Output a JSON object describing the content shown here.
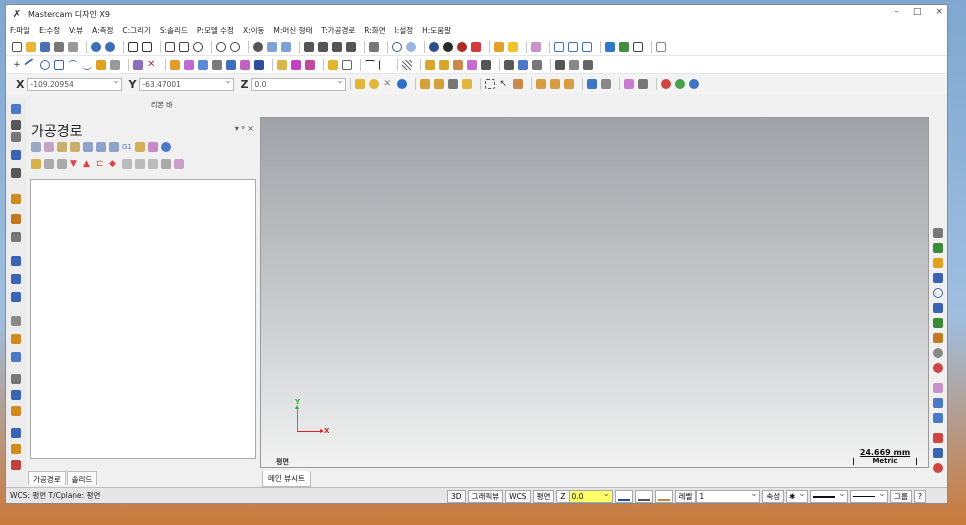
{
  "window": {
    "title": "Mastercam 디자인 X9",
    "controls": [
      "–",
      "□",
      "×"
    ]
  },
  "menu": {
    "items": [
      "F:파일",
      "E:수정",
      "V:뷰",
      "A:측정",
      "C:그리기",
      "S:솔리드",
      "P:모델 수정",
      "X:이동",
      "M:머신 형태",
      "T:가공경로",
      "R:화면",
      "I:설정",
      "H:도움말"
    ]
  },
  "coords": {
    "x_label": "X",
    "x_value": "-109.20954",
    "y_label": "Y",
    "y_value": "-63.47001",
    "z_label": "Z",
    "z_value": "0.0"
  },
  "ribbon": {
    "label": "리본 바"
  },
  "toolpaths_panel": {
    "title": "가공경로",
    "pin": "▾ ᵠ ×",
    "tabs": [
      "가공경로",
      "솔리드"
    ]
  },
  "viewport": {
    "x_axis": "X",
    "y_axis": "Y",
    "plane_name": "평면",
    "scale_value": "24.669 mm",
    "scale_unit": "Metric",
    "viewsheet_tab": "메인 뷰시트",
    "background_top": "#9fa3a7",
    "background_bottom": "#f2f2f2"
  },
  "status": {
    "left_text": "WCS: 평면  T/Cplane: 평면",
    "btn_3d": "3D",
    "btn_gview": "그래픽뷰",
    "btn_wcs": "WCS",
    "btn_plane": "평면",
    "z_label": "Z",
    "z_value": "0.0",
    "level_label": "레벨",
    "level_value": "1",
    "attr_label": "속성",
    "group_label": "그룹",
    "help": "?"
  }
}
